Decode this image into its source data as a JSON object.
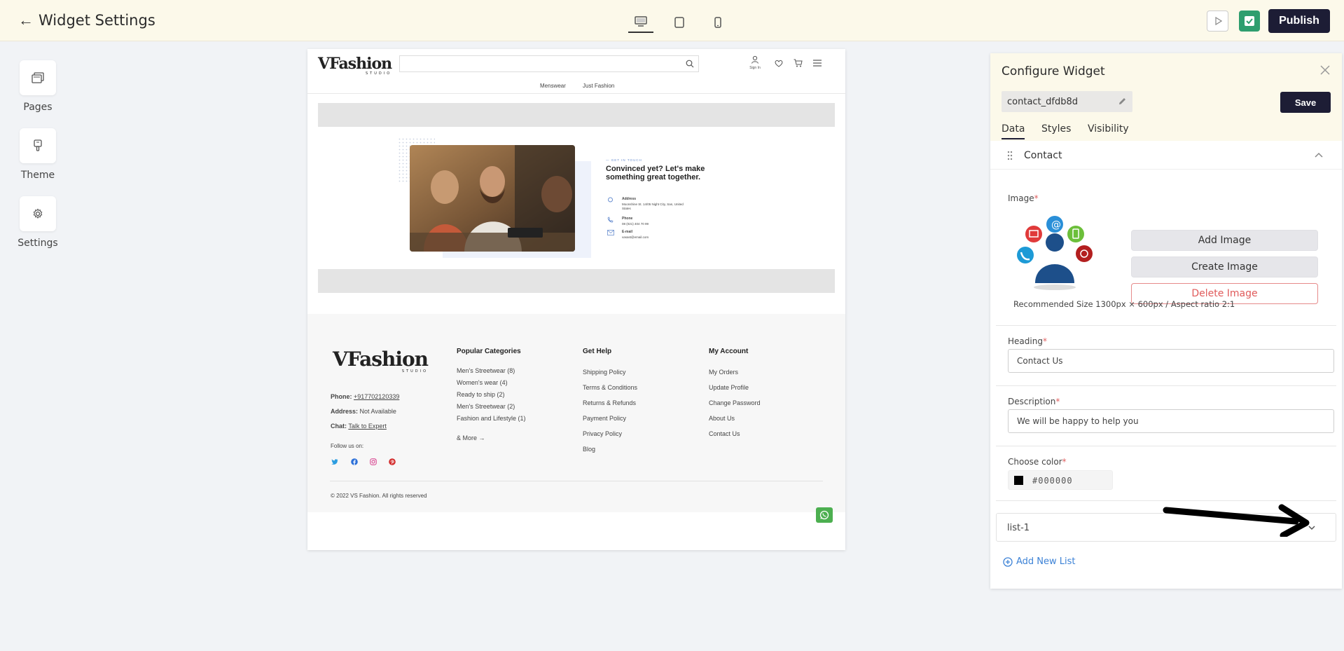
{
  "topbar": {
    "title": "Widget Settings",
    "publish_label": "Publish"
  },
  "sidebar": {
    "items": [
      {
        "label": "Pages"
      },
      {
        "label": "Theme"
      },
      {
        "label": "Settings"
      }
    ]
  },
  "canvas": {
    "logo": "VFashion",
    "logo_sub": "STUDIO",
    "sign_in": "Sign In",
    "nav": [
      "Menswear",
      "Just Fashion"
    ],
    "contact": {
      "kicker": "— GET IN TOUCH",
      "heading": "Convinced yet? Let's make something great together.",
      "address_label": "Address",
      "address_value": "Moonshine St. 14/05 Night City, San, United States",
      "phone_label": "Phone",
      "phone_value": "08 (021) 404 70 99",
      "email_label": "E-mail",
      "email_value": "vasast@email.com"
    },
    "footer": {
      "phone_label": "Phone:",
      "phone_value": "+917702120339",
      "address_label": "Address:",
      "address_value": "Not Available",
      "chat_label": "Chat:",
      "chat_value": "Talk to Expert",
      "follow": "Follow us on:",
      "col1_title": "Popular Categories",
      "col1_links": [
        "Men's Streetwear (8)",
        "Women's wear (4)",
        "Ready to ship (2)",
        "Men's Streetwear (2)",
        "Fashion and Lifestyle (1)"
      ],
      "col1_more": "& More →",
      "col2_title": "Get Help",
      "col2_links": [
        "Shipping Policy",
        "Terms & Conditions",
        "Returns & Refunds",
        "Payment Policy",
        "Privacy Policy",
        "Blog"
      ],
      "col3_title": "My Account",
      "col3_links": [
        "My Orders",
        "Update Profile",
        "Change Password",
        "About Us",
        "Contact Us"
      ],
      "copyright": "© 2022 VS Fashion. All rights reserved"
    }
  },
  "panel": {
    "title": "Configure Widget",
    "widget_name": "contact_dfdb8d",
    "save_label": "Save",
    "tabs": [
      "Data",
      "Styles",
      "Visibility"
    ],
    "section": "Contact",
    "image_label": "Image",
    "add_image": "Add Image",
    "create_image": "Create Image",
    "delete_image": "Delete Image",
    "recommended": "Recommended Size 1300px × 600px / Aspect ratio 2:1",
    "heading_label": "Heading",
    "heading_value": "Contact Us",
    "description_label": "Description",
    "description_value": "We will be happy to help you",
    "color_label": "Choose color",
    "color_value": "#000000",
    "list_label": "list-1",
    "add_list": "Add New List",
    "required_mark": "*"
  },
  "colors": {
    "accent": "#1d1d35",
    "topbar_bg": "#fcf9ea",
    "link_blue": "#3c82d6",
    "delete_red": "#e05a5a",
    "whatsapp": "#4caf50"
  }
}
